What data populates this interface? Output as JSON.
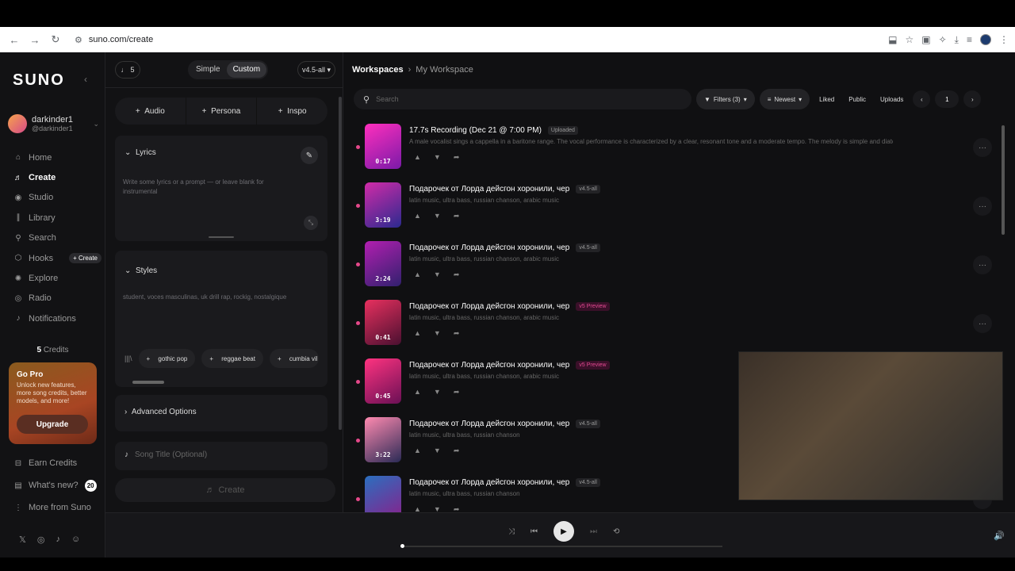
{
  "browser": {
    "url": "suno.com/create"
  },
  "sidebar": {
    "logo": "SUNO",
    "user": {
      "name": "darkinder1",
      "handle": "@darkinder1"
    },
    "nav": [
      {
        "label": "Home",
        "icon": "home-icon"
      },
      {
        "label": "Create",
        "icon": "create-icon",
        "active": true
      },
      {
        "label": "Studio",
        "icon": "studio-icon"
      },
      {
        "label": "Library",
        "icon": "library-icon"
      },
      {
        "label": "Search",
        "icon": "search-icon"
      },
      {
        "label": "Hooks",
        "icon": "hooks-icon",
        "badge": "+ Create"
      },
      {
        "label": "Explore",
        "icon": "explore-icon"
      },
      {
        "label": "Radio",
        "icon": "radio-icon"
      },
      {
        "label": "Notifications",
        "icon": "bell-icon"
      }
    ],
    "credits": {
      "count": "5",
      "label": "Credits"
    },
    "gopro": {
      "title": "Go Pro",
      "desc": "Unlock new features, more song credits, better models, and more!",
      "button": "Upgrade"
    },
    "bottom": [
      {
        "label": "Earn Credits"
      },
      {
        "label": "What's new?",
        "badge": "20"
      },
      {
        "label": "More from Suno"
      }
    ]
  },
  "create": {
    "credits_count": "5",
    "mode": {
      "simple": "Simple",
      "custom": "Custom"
    },
    "model": "v4.5-all",
    "add_buttons": [
      "Audio",
      "Persona",
      "Inspo"
    ],
    "lyrics": {
      "label": "Lyrics",
      "placeholder": "Write some lyrics or a prompt — or leave blank for instrumental"
    },
    "styles": {
      "label": "Styles",
      "placeholder": "student, voces masculinas, uk drill rap, rockig, nostalgique",
      "chips": [
        "gothic pop",
        "reggae beat",
        "cumbia vil"
      ]
    },
    "advanced": "Advanced Options",
    "song_title_placeholder": "Song Title (Optional)",
    "create_button": "Create"
  },
  "workspace": {
    "breadcrumb": [
      "Workspaces",
      "My Workspace"
    ],
    "search_placeholder": "Search",
    "filters": {
      "filters": "Filters (3)",
      "sort": "Newest",
      "liked": "Liked",
      "public": "Public",
      "uploads": "Uploads",
      "page": "1"
    },
    "songs": [
      {
        "title": "17.7s Recording (Dec 21 @ 7:00 PM)",
        "tag": "Uploaded",
        "tag_style": "plain",
        "desc": "A male vocalist sings a cappella in a baritone range. The vocal performance is characterized by a clear, resonant tone and a moderate tempo. The melody is simple and diatonic, wi...",
        "duration": "0:17",
        "colors": [
          "#ff2fbd",
          "#7a1aa8"
        ]
      },
      {
        "title": "Подарочек от Лорда дейсгон хоронили, чер",
        "tag": "v4.5-all",
        "tag_style": "plain",
        "desc": "latin music, ultra bass, russian chanson, arabic music",
        "duration": "3:19",
        "colors": [
          "#d12ba8",
          "#2b2a8f"
        ]
      },
      {
        "title": "Подарочек от Лорда дейсгон хоронили, чер",
        "tag": "v4.5-all",
        "tag_style": "plain",
        "desc": "latin music, ultra bass, russian chanson, arabic music",
        "duration": "2:24",
        "colors": [
          "#b21fb0",
          "#31206e"
        ]
      },
      {
        "title": "Подарочек от Лорда дейсгон хоронили, чер",
        "tag": "v5 Preview",
        "tag_style": "v5",
        "desc": "latin music, ultra bass, russian chanson, arabic music",
        "duration": "0:41",
        "colors": [
          "#e8305f",
          "#4a1030"
        ]
      },
      {
        "title": "Подарочек от Лорда дейсгон хоронили, чер",
        "tag": "v5 Preview",
        "tag_style": "v5",
        "desc": "latin music, ultra bass, russian chanson, arabic music",
        "duration": "0:45",
        "colors": [
          "#ff3380",
          "#6a1055"
        ]
      },
      {
        "title": "Подарочек от Лорда дейсгон хоронили, чер",
        "tag": "v4.5-all",
        "tag_style": "plain",
        "desc": "latin music, ultra bass, russian chanson",
        "duration": "3:22",
        "colors": [
          "#ff8ab0",
          "#2a2a55"
        ]
      },
      {
        "title": "Подарочек от Лорда дейсгон хоронили, чер",
        "tag": "v4.5-all",
        "tag_style": "plain",
        "desc": "latin music, ultra bass, russian chanson",
        "duration": "",
        "colors": [
          "#2b6fbf",
          "#8a1f8a"
        ]
      }
    ]
  },
  "player": {
    "progress": 0.0
  }
}
